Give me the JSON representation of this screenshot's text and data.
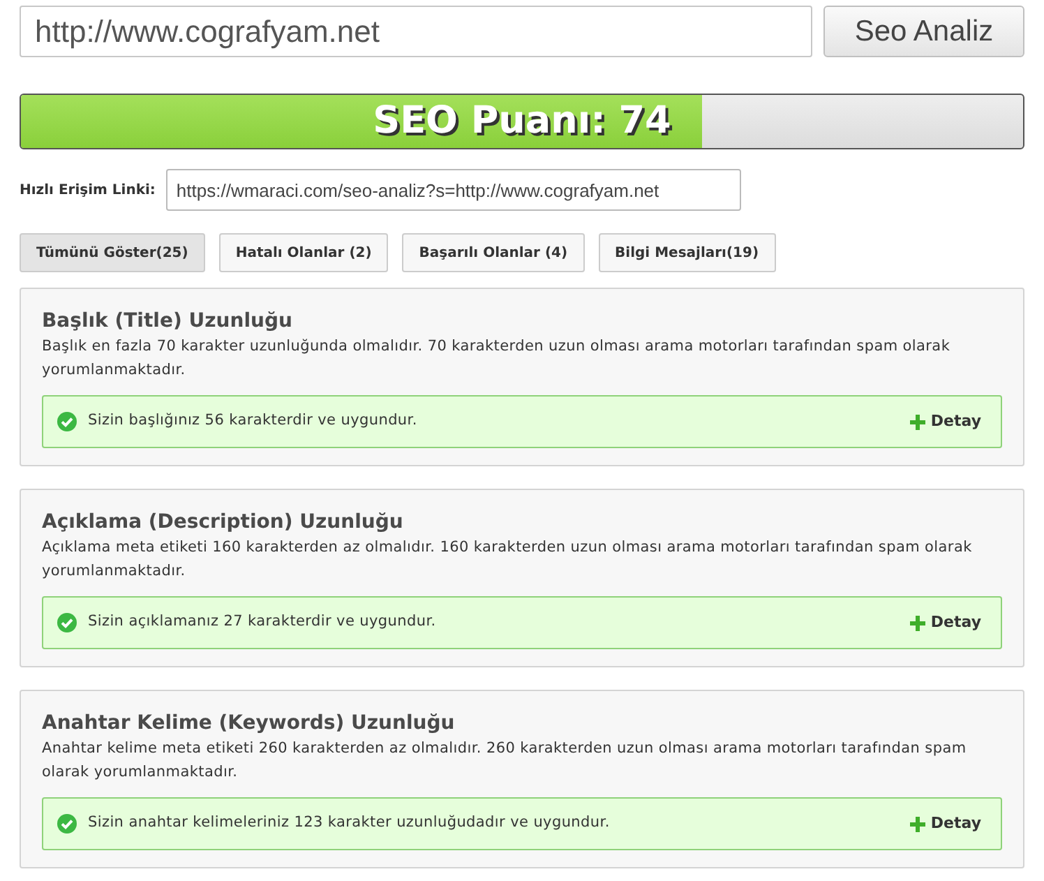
{
  "url_field": {
    "value": "http://www.cografyam.net"
  },
  "analyze_button": "Seo Analiz",
  "score_bar": {
    "label": "SEO Puanı: 74",
    "level": 0.68
  },
  "quick_link": {
    "label": "Hızlı Erişim Linki:",
    "value": "https://wmaraci.com/seo-analiz?s=http://www.cografyam.net"
  },
  "filters": [
    {
      "label": "Tümünü Göster(25)",
      "selected": true
    },
    {
      "label": "Hatalı Olanlar (2)",
      "selected": false
    },
    {
      "label": "Başarılı Olanlar (4)",
      "selected": false
    },
    {
      "label": "Bilgi Mesajları(19)",
      "selected": false
    }
  ],
  "checks": [
    {
      "title": "Başlık (Title) Uzunluğu",
      "description": "Başlık en fazla 70 karakter uzunluğunda olmalıdır. 70 karakterden uzun olması arama motorları tarafından spam olarak yorumlanmaktadır.",
      "kind": "success",
      "result": "Sizin başlığınız 56 karakterdir ve uygundur.",
      "detail": "Detay"
    },
    {
      "title": "Açıklama (Description) Uzunluğu",
      "description": "Açıklama meta etiketi 160 karakterden az olmalıdır. 160 karakterden uzun olması arama motorları tarafından spam olarak yorumlanmaktadır.",
      "kind": "success",
      "result": "Sizin açıklamanız 27 karakterdir ve uygundur.",
      "detail": "Detay"
    },
    {
      "title": "Anahtar Kelime (Keywords) Uzunluğu",
      "description": "Anahtar kelime meta etiketi 260 karakterden az olmalıdır. 260 karakterden uzun olması arama motorları tarafından spam olarak yorumlanmaktadır.",
      "kind": "success",
      "result": "Sizin anahtar kelimeleriniz 123 karakter uzunluğudadır ve uygundur.",
      "detail": "Detay"
    }
  ]
}
